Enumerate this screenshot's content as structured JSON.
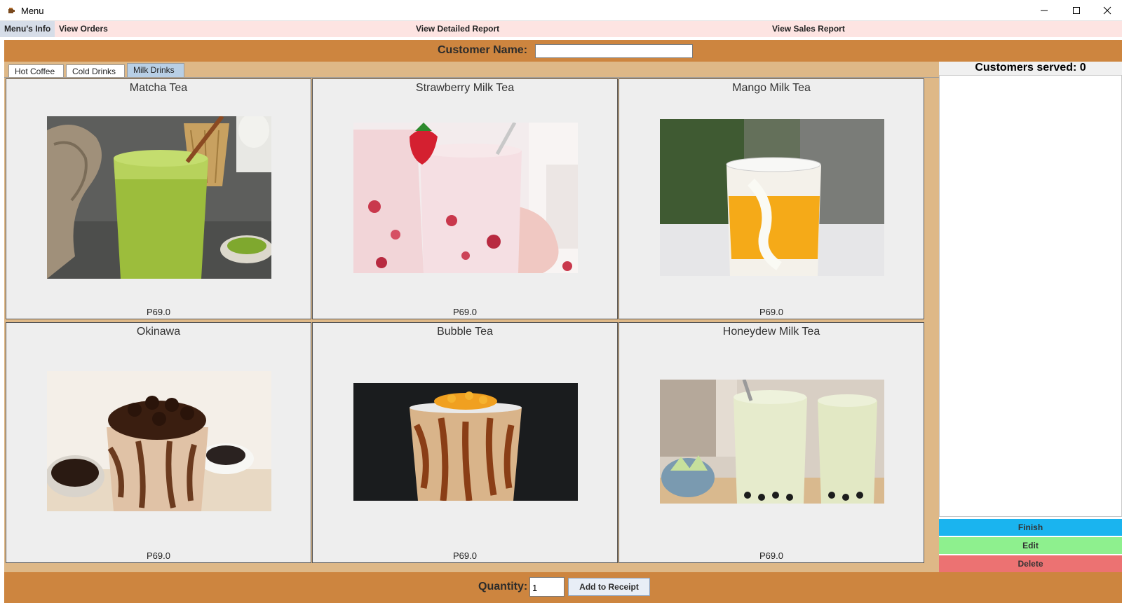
{
  "window": {
    "title": "Menu"
  },
  "menubar": {
    "items": [
      "Menu's Info",
      "View Orders",
      "View Detailed Report",
      "View Sales Report"
    ]
  },
  "header": {
    "customer_label": "Customer Name:",
    "customer_value": ""
  },
  "tabs": [
    "Hot Coffee",
    "Cold Drinks",
    "Milk Drinks"
  ],
  "active_tab": "Milk Drinks",
  "products": [
    {
      "name": "Matcha Tea",
      "price": "P69.0"
    },
    {
      "name": "Strawberry Milk Tea",
      "price": "P69.0"
    },
    {
      "name": "Mango Milk Tea",
      "price": "P69.0"
    },
    {
      "name": "Okinawa",
      "price": "P69.0"
    },
    {
      "name": "Bubble Tea",
      "price": "P69.0"
    },
    {
      "name": "Honeydew Milk Tea",
      "price": "P69.0"
    }
  ],
  "footer": {
    "quantity_label": "Quantity:",
    "quantity_value": "1",
    "add_button": "Add to Receipt"
  },
  "side": {
    "served_label": "Customers served: 0",
    "finish": "Finish",
    "edit": "Edit",
    "delete": "Delete"
  },
  "colors": {
    "accent_orange": "#cd853f",
    "panel_tan": "#deb887",
    "finish": "#1ab4ef",
    "edit": "#8ef08e",
    "delete": "#ec7272"
  }
}
